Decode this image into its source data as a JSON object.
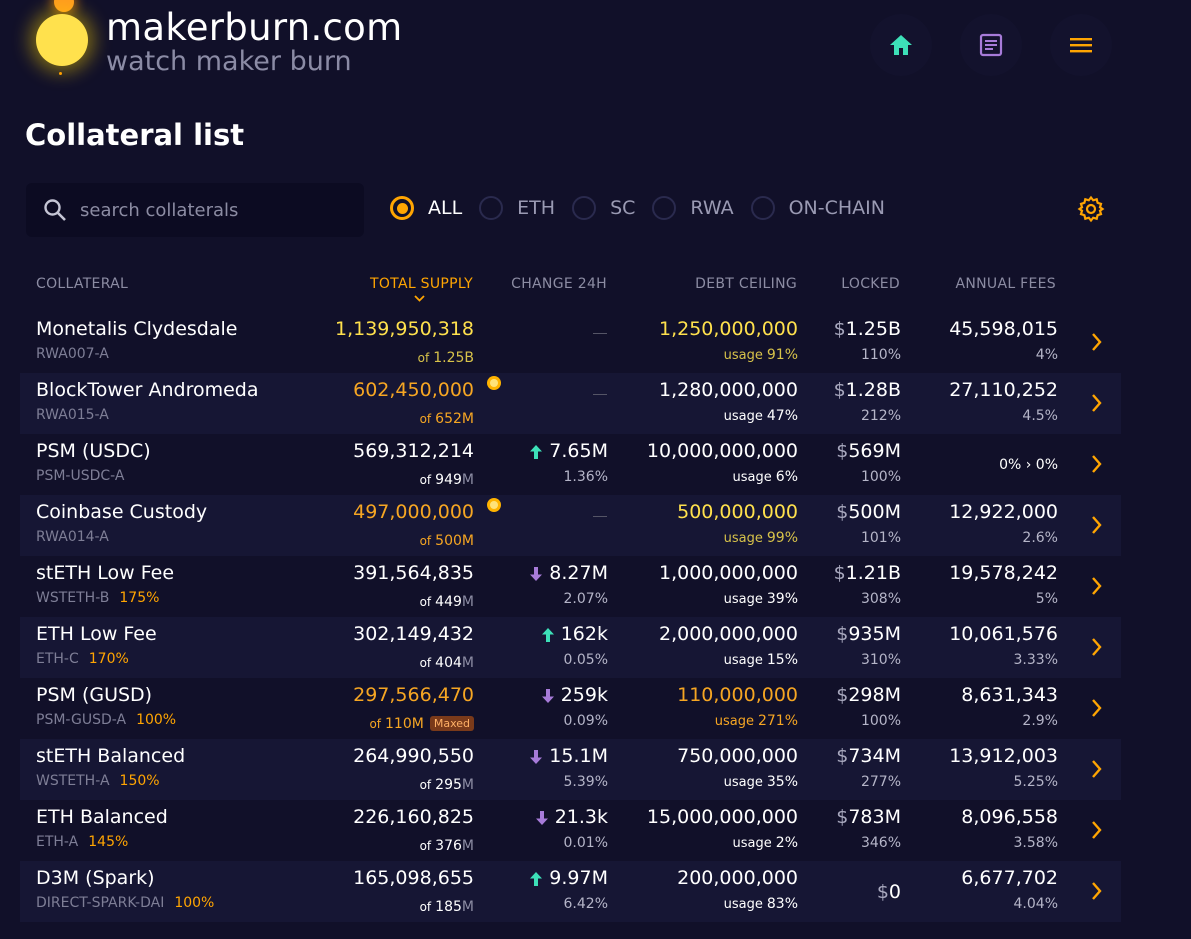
{
  "brand": {
    "title": "makerburn.com",
    "subtitle": "watch maker burn"
  },
  "page_title": "Collateral list",
  "search": {
    "placeholder": "search collaterals",
    "value": ""
  },
  "filters": [
    {
      "label": "ALL",
      "selected": true
    },
    {
      "label": "ETH",
      "selected": false
    },
    {
      "label": "SC",
      "selected": false
    },
    {
      "label": "RWA",
      "selected": false
    },
    {
      "label": "ON-CHAIN",
      "selected": false
    }
  ],
  "columns": {
    "collateral": "COLLATERAL",
    "total_supply": "TOTAL SUPPLY",
    "change": "CHANGE 24H",
    "debt_ceiling": "DEBT CEILING",
    "locked": "LOCKED",
    "fees": "ANNUAL FEES"
  },
  "labels": {
    "of": "of",
    "usage": "usage",
    "maxed": "Maxed",
    "dollar": "$"
  },
  "colors": {
    "accent": "#ffa502",
    "background": "#111029",
    "alt_row": "#161634",
    "up": "#3de0b8",
    "down": "#a77bd9"
  },
  "rows": [
    {
      "name": "Monetalis Clydesdale",
      "ilk": "RWA007-A",
      "ratio": "",
      "supply": "1,139,950,318",
      "supply_style": "yellow",
      "of_num": "1.25",
      "of_unit": "B",
      "change": "",
      "change_dir": "",
      "change_pct": "",
      "dc": "1,250,000,000",
      "dc_style": "yellow",
      "usage": "91%",
      "locked": "1.25B",
      "locked_pct": "110%",
      "fees": "45,598,015",
      "fees_pct": "4%",
      "badge": false,
      "maxed": false
    },
    {
      "name": "BlockTower Andromeda",
      "ilk": "RWA015-A",
      "ratio": "",
      "supply": "602,450,000",
      "supply_style": "orange",
      "of_num": "652",
      "of_unit": "M",
      "change": "",
      "change_dir": "",
      "change_pct": "",
      "dc": "1,280,000,000",
      "dc_style": "",
      "usage": "47%",
      "locked": "1.28B",
      "locked_pct": "212%",
      "fees": "27,110,252",
      "fees_pct": "4.5%",
      "badge": true,
      "maxed": false
    },
    {
      "name": "PSM (USDC)",
      "ilk": "PSM-USDC-A",
      "ratio": "",
      "supply": "569,312,214",
      "supply_style": "",
      "of_num": "949",
      "of_unit": "M",
      "change": "7.65M",
      "change_dir": "up",
      "change_pct": "1.36%",
      "dc": "10,000,000,000",
      "dc_style": "",
      "usage": "6%",
      "locked": "569M",
      "locked_pct": "100%",
      "fees": "0% › 0%",
      "fees_pct": "",
      "badge": false,
      "maxed": false
    },
    {
      "name": "Coinbase Custody",
      "ilk": "RWA014-A",
      "ratio": "",
      "supply": "497,000,000",
      "supply_style": "orange",
      "of_num": "500",
      "of_unit": "M",
      "change": "",
      "change_dir": "",
      "change_pct": "",
      "dc": "500,000,000",
      "dc_style": "yellow",
      "usage": "99%",
      "locked": "500M",
      "locked_pct": "101%",
      "fees": "12,922,000",
      "fees_pct": "2.6%",
      "badge": true,
      "maxed": false
    },
    {
      "name": "stETH Low Fee",
      "ilk": "WSTETH-B",
      "ratio": "175%",
      "supply": "391,564,835",
      "supply_style": "",
      "of_num": "449",
      "of_unit": "M",
      "change": "8.27M",
      "change_dir": "down",
      "change_pct": "2.07%",
      "dc": "1,000,000,000",
      "dc_style": "",
      "usage": "39%",
      "locked": "1.21B",
      "locked_pct": "308%",
      "fees": "19,578,242",
      "fees_pct": "5%",
      "badge": false,
      "maxed": false
    },
    {
      "name": "ETH Low Fee",
      "ilk": "ETH-C",
      "ratio": "170%",
      "supply": "302,149,432",
      "supply_style": "",
      "of_num": "404",
      "of_unit": "M",
      "change": "162k",
      "change_dir": "up",
      "change_pct": "0.05%",
      "dc": "2,000,000,000",
      "dc_style": "",
      "usage": "15%",
      "locked": "935M",
      "locked_pct": "310%",
      "fees": "10,061,576",
      "fees_pct": "3.33%",
      "badge": false,
      "maxed": false
    },
    {
      "name": "PSM (GUSD)",
      "ilk": "PSM-GUSD-A",
      "ratio": "100%",
      "supply": "297,566,470",
      "supply_style": "orange",
      "of_num": "110",
      "of_unit": "M",
      "change": "259k",
      "change_dir": "down",
      "change_pct": "0.09%",
      "dc": "110,000,000",
      "dc_style": "orange",
      "usage": "271%",
      "locked": "298M",
      "locked_pct": "100%",
      "fees": "8,631,343",
      "fees_pct": "2.9%",
      "badge": false,
      "maxed": true
    },
    {
      "name": "stETH Balanced",
      "ilk": "WSTETH-A",
      "ratio": "150%",
      "supply": "264,990,550",
      "supply_style": "",
      "of_num": "295",
      "of_unit": "M",
      "change": "15.1M",
      "change_dir": "down",
      "change_pct": "5.39%",
      "dc": "750,000,000",
      "dc_style": "",
      "usage": "35%",
      "locked": "734M",
      "locked_pct": "277%",
      "fees": "13,912,003",
      "fees_pct": "5.25%",
      "badge": false,
      "maxed": false
    },
    {
      "name": "ETH Balanced",
      "ilk": "ETH-A",
      "ratio": "145%",
      "supply": "226,160,825",
      "supply_style": "",
      "of_num": "376",
      "of_unit": "M",
      "change": "21.3k",
      "change_dir": "down",
      "change_pct": "0.01%",
      "dc": "15,000,000,000",
      "dc_style": "",
      "usage": "2%",
      "locked": "783M",
      "locked_pct": "346%",
      "fees": "8,096,558",
      "fees_pct": "3.58%",
      "badge": false,
      "maxed": false
    },
    {
      "name": "D3M (Spark)",
      "ilk": "DIRECT-SPARK-DAI",
      "ratio": "100%",
      "supply": "165,098,655",
      "supply_style": "",
      "of_num": "185",
      "of_unit": "M",
      "change": "9.97M",
      "change_dir": "up",
      "change_pct": "6.42%",
      "dc": "200,000,000",
      "dc_style": "",
      "usage": "83%",
      "locked": "0",
      "locked_pct": "",
      "fees": "6,677,702",
      "fees_pct": "4.04%",
      "badge": false,
      "maxed": false
    }
  ]
}
